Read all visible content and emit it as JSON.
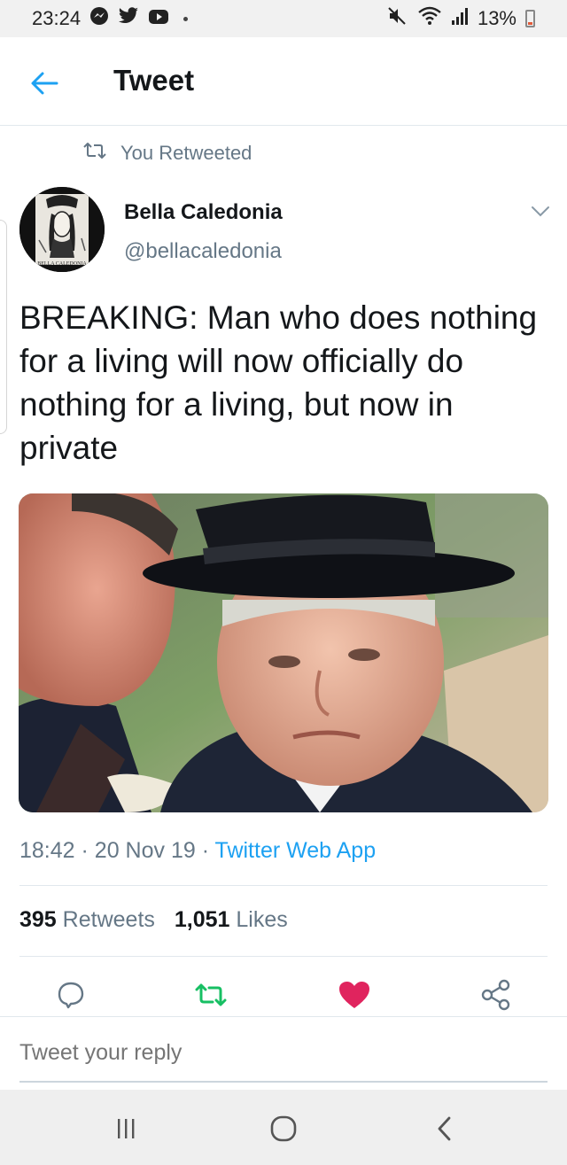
{
  "status_bar": {
    "time": "23:24",
    "battery": "13%",
    "icons": [
      "messenger-icon",
      "twitter-icon",
      "youtube-icon",
      "mute-icon",
      "wifi-icon",
      "signal-icon",
      "battery-icon"
    ]
  },
  "header": {
    "title": "Tweet"
  },
  "retweet_context": {
    "label": "You Retweeted"
  },
  "tweet": {
    "author_name": "Bella Caledonia",
    "author_handle": "@bellacaledonia",
    "avatar_text": "BELLA CALEDONIA",
    "text": "BREAKING: Man who does nothing for a living will now officially do nothing for a living, but now in private",
    "time": "18:42",
    "date": "20 Nov 19",
    "source": "Twitter Web App",
    "separator": "·"
  },
  "stats": {
    "retweets_count": "395",
    "retweets_label": "Retweets",
    "likes_count": "1,051",
    "likes_label": "Likes"
  },
  "reply": {
    "placeholder": "Tweet your reply"
  },
  "colors": {
    "accent": "#1da1f2",
    "retweet_green": "#17bf63",
    "like_red": "#e0245e",
    "muted": "#657786"
  }
}
